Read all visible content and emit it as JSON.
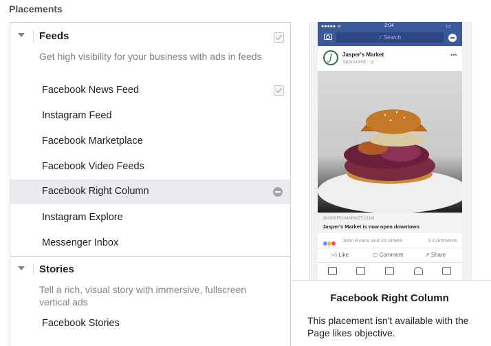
{
  "page": {
    "title": "Placements"
  },
  "feeds": {
    "title": "Feeds",
    "description": "Get high visibility for your business with ads in feeds",
    "items": [
      {
        "label": "Facebook News Feed"
      },
      {
        "label": "Instagram Feed"
      },
      {
        "label": "Facebook Marketplace"
      },
      {
        "label": "Facebook Video Feeds"
      },
      {
        "label": "Facebook Right Column"
      },
      {
        "label": "Instagram Explore"
      },
      {
        "label": "Messenger Inbox"
      }
    ]
  },
  "stories": {
    "title": "Stories",
    "description": "Tell a rich, visual story with immersive, fullscreen vertical ads",
    "items": [
      {
        "label": "Facebook Stories"
      }
    ]
  },
  "preview": {
    "status_time": "2:04",
    "search_placeholder": "Search",
    "page_name": "Jasper's Market",
    "sponsored": "Sponsored · ◎",
    "more": "•••",
    "link_domain": "JASPERS-MARKET.COM",
    "link_title": "Jasper's Market is now open downtown",
    "reactions_text": "John Evans and 23 others",
    "comments_text": "2 Comments",
    "like_label": "Like",
    "comment_label": "Comment",
    "share_label": "Share"
  },
  "info": {
    "title": "Facebook Right Column",
    "description": "This placement isn't available with the Page likes objective."
  },
  "colors": {
    "facebook_blue": "#3b5998",
    "highlight": "#e9ebee"
  }
}
